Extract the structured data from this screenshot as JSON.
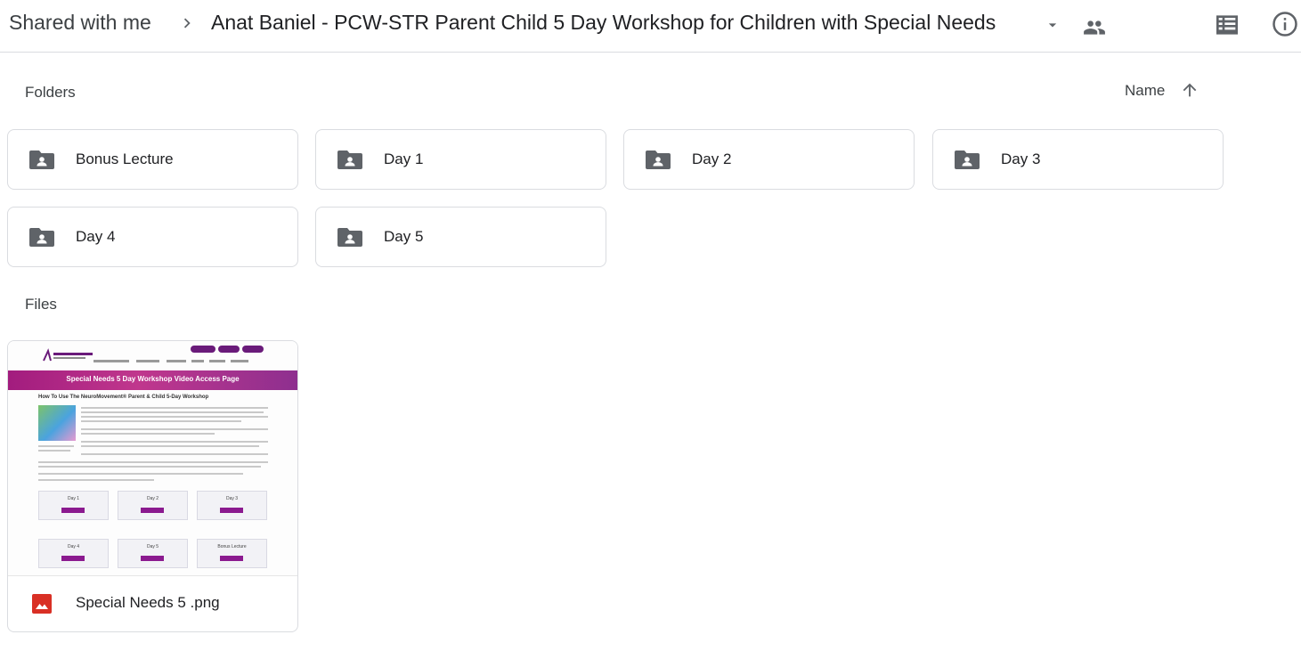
{
  "breadcrumb": {
    "root": "Shared with me",
    "current": "Anat Baniel - PCW-STR Parent Child 5 Day Workshop for Children with Special Needs"
  },
  "sections": {
    "folders_label": "Folders",
    "files_label": "Files",
    "sort_label": "Name"
  },
  "folders": [
    {
      "name": "Bonus Lecture"
    },
    {
      "name": "Day 1"
    },
    {
      "name": "Day 2"
    },
    {
      "name": "Day 3"
    },
    {
      "name": "Day 4"
    },
    {
      "name": "Day 5"
    }
  ],
  "files": [
    {
      "name": "Special Needs 5 .png",
      "thumbnail": {
        "banner": "Special Needs 5 Day Workshop Video Access Page",
        "heading": "How To Use The NeuroMovement® Parent & Child 5-Day Workshop",
        "boxes": [
          "Day 1",
          "Day 2",
          "Day 3",
          "Day 4",
          "Day 5",
          "Bonus Lecture"
        ]
      }
    }
  ],
  "icons": {
    "separator": "chevron-right-icon",
    "caret": "caret-down-icon",
    "shared": "shared-people-icon",
    "list_view": "list-view-icon",
    "info": "info-icon",
    "sort": "arrow-up-icon",
    "folder": "shared-folder-icon",
    "image_file": "image-file-icon"
  },
  "colors": {
    "icon_gray": "#5f6368",
    "border": "#dadce0",
    "image_icon_red": "#d93025",
    "banner_purple": "#a21c7e"
  }
}
